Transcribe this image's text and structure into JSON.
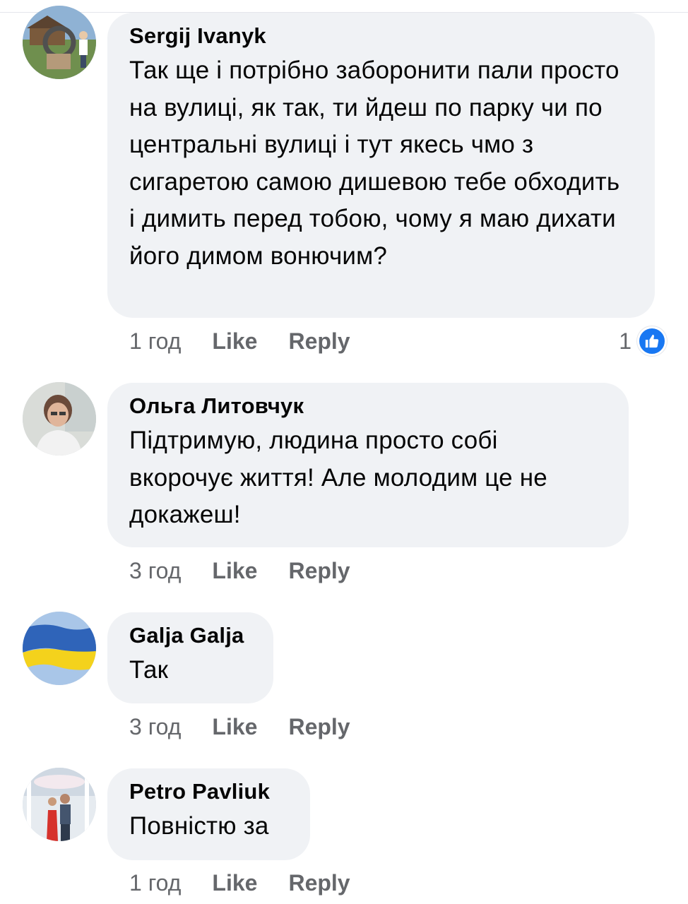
{
  "colors": {
    "bubble_bg": "#f0f2f5",
    "meta_text": "#65676b",
    "like_blue": "#1877f2"
  },
  "comments": [
    {
      "author": "Sergij Ivanyk",
      "text": "Так ще і потрібно заборонити пали просто на вулиці, як так, ти йдеш по парку чи по центральні вулиці і тут якесь чмо з сигаретою самою дишевою тебе обходить і димить перед тобою, чому я маю дихати його димом вонючим?",
      "time": "1 год",
      "like_label": "Like",
      "reply_label": "Reply",
      "reaction_count": "1",
      "reaction_icon": "thumbs-up-icon"
    },
    {
      "author": "Ольга Литовчук",
      "text": "Підтримую, людина просто собі вкорочує життя! Але молодим це не докажеш!",
      "time": "3 год",
      "like_label": "Like",
      "reply_label": "Reply"
    },
    {
      "author": "Galja Galja",
      "text": "Так",
      "time": "3 год",
      "like_label": "Like",
      "reply_label": "Reply"
    },
    {
      "author": "Petro Pavliuk",
      "text": "Повністю за",
      "time": "1 год",
      "like_label": "Like",
      "reply_label": "Reply"
    }
  ]
}
